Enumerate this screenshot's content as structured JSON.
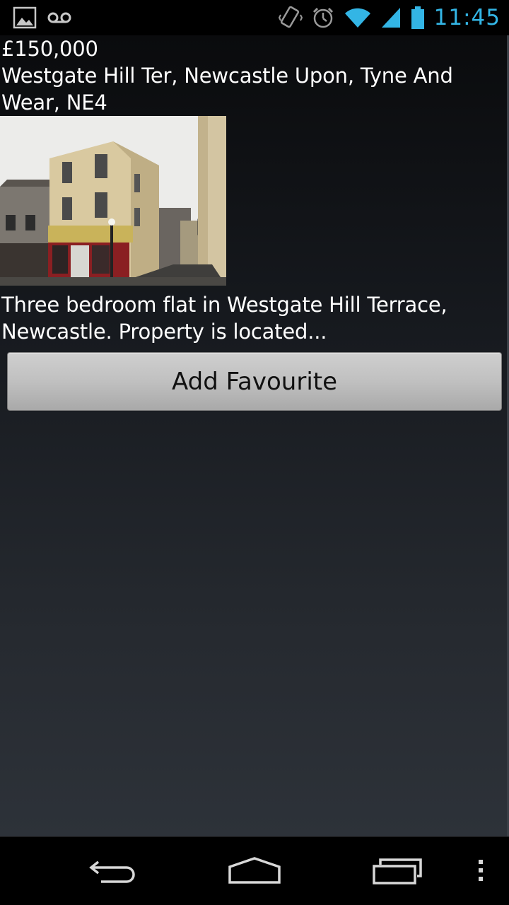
{
  "status_bar": {
    "left_icons": [
      "gallery-notification-icon",
      "voicemail-icon"
    ],
    "right_icons": [
      "vibrate-icon",
      "alarm-icon",
      "wifi-icon",
      "cell-signal-icon",
      "battery-icon"
    ],
    "time": "11:45",
    "time_color": "#33b5e5"
  },
  "listing": {
    "price": "£150,000",
    "address": "Westgate Hill Ter, Newcastle Upon, Tyne And Wear, NE4",
    "description": "Three bedroom flat in Westgate Hill Terrace, Newcastle. Property is located...",
    "add_favourite_label": "Add Favourite"
  },
  "nav_bar": {
    "buttons": [
      "back-icon",
      "home-icon",
      "recent-apps-icon",
      "menu-icon"
    ]
  }
}
